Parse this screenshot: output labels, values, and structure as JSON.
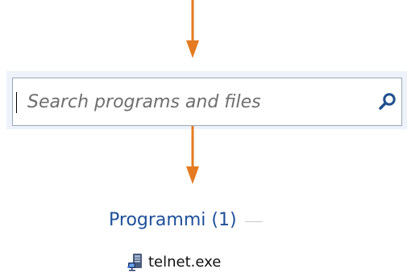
{
  "colors": {
    "arrow": "#e47b20",
    "search_strip": "#eef3fb",
    "search_border": "#9aa7b8",
    "results_title": "#1e4f9a",
    "text": "#101010"
  },
  "search": {
    "placeholder": "Search programs and files",
    "value": "",
    "icon": "search-icon"
  },
  "results": {
    "group_title": "Programmi (1)",
    "items": [
      {
        "label": "telnet.exe",
        "icon": "telnet-program-icon"
      }
    ]
  }
}
